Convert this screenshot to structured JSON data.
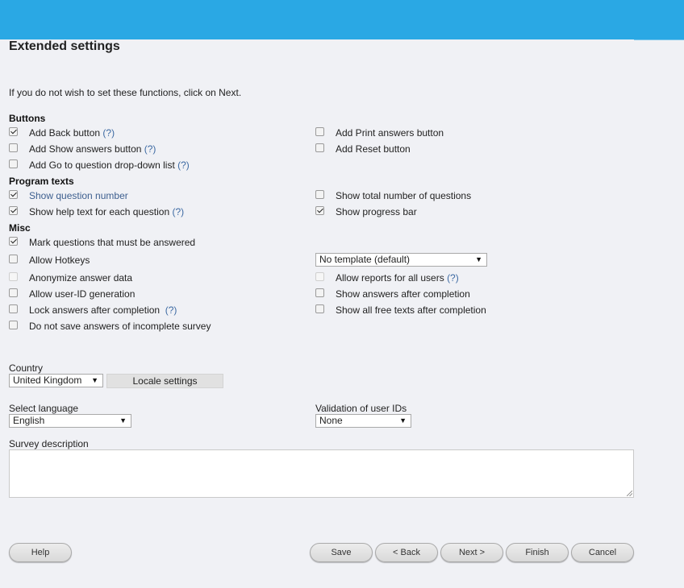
{
  "header": {
    "title": "Extended settings"
  },
  "intro": "If you do not wish to set these functions, click on Next.",
  "sections": {
    "buttons": "Buttons",
    "program_texts": "Program texts",
    "misc": "Misc"
  },
  "options": {
    "back_button": "Add Back button",
    "print_answers": "Add Print answers button",
    "show_answers_button": "Add Show answers button",
    "reset_button": "Add Reset button",
    "goto_dropdown": "Add Go to question drop-down list",
    "show_question_number": "Show question number",
    "show_total_questions": "Show total number of questions",
    "show_help_text": "Show help text for each question",
    "show_progress_bar": "Show progress bar",
    "mark_required": "Mark questions that must be answered",
    "allow_hotkeys": "Allow Hotkeys",
    "anonymize": "Anonymize answer data",
    "allow_reports": "Allow reports for all users",
    "allow_userid": "Allow user-ID generation",
    "show_answers_after": "Show answers after completion",
    "lock_answers": "Lock answers after completion",
    "show_free_texts": "Show all free texts after completion",
    "no_save_incomplete": "Do not save answers of incomplete survey"
  },
  "help_marker": "(?)",
  "template_select": {
    "value": "No template (default)"
  },
  "country": {
    "label": "Country",
    "value": "United Kingdom",
    "locale_button": "Locale settings"
  },
  "language": {
    "label": "Select language",
    "value": "English"
  },
  "validation": {
    "label": "Validation of user IDs",
    "value": "None"
  },
  "description": {
    "label": "Survey description",
    "value": ""
  },
  "footer": {
    "help": "Help",
    "save": "Save",
    "back": "< Back",
    "next": "Next >",
    "finish": "Finish",
    "cancel": "Cancel"
  },
  "colors": {
    "topbar": "#2aa8e4",
    "background": "#f0f1f5",
    "help_link": "#3d6aa3"
  }
}
